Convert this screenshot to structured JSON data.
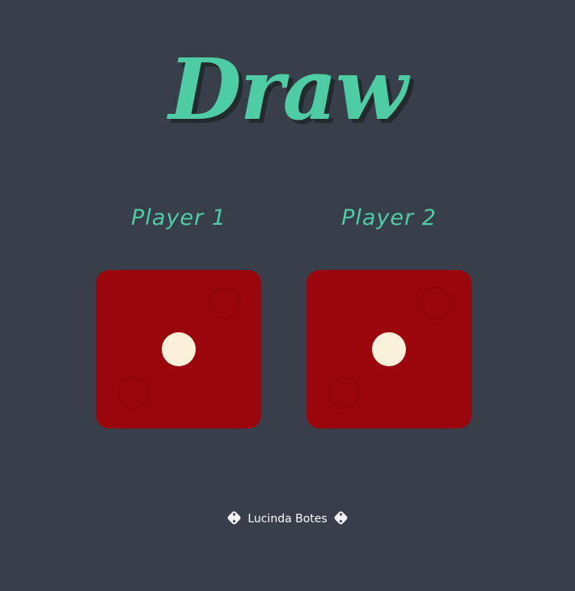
{
  "header": {
    "title": "Draw"
  },
  "players": [
    {
      "label": "Player 1",
      "die_value": 1
    },
    {
      "label": "Player 2",
      "die_value": 1
    }
  ],
  "footer": {
    "author": "Lucinda Botes",
    "icon": "dice-icon"
  },
  "colors": {
    "background": "#393f4a",
    "accent": "#4ecca3",
    "die": "#9a060c",
    "pip": "#fbf0d9"
  }
}
